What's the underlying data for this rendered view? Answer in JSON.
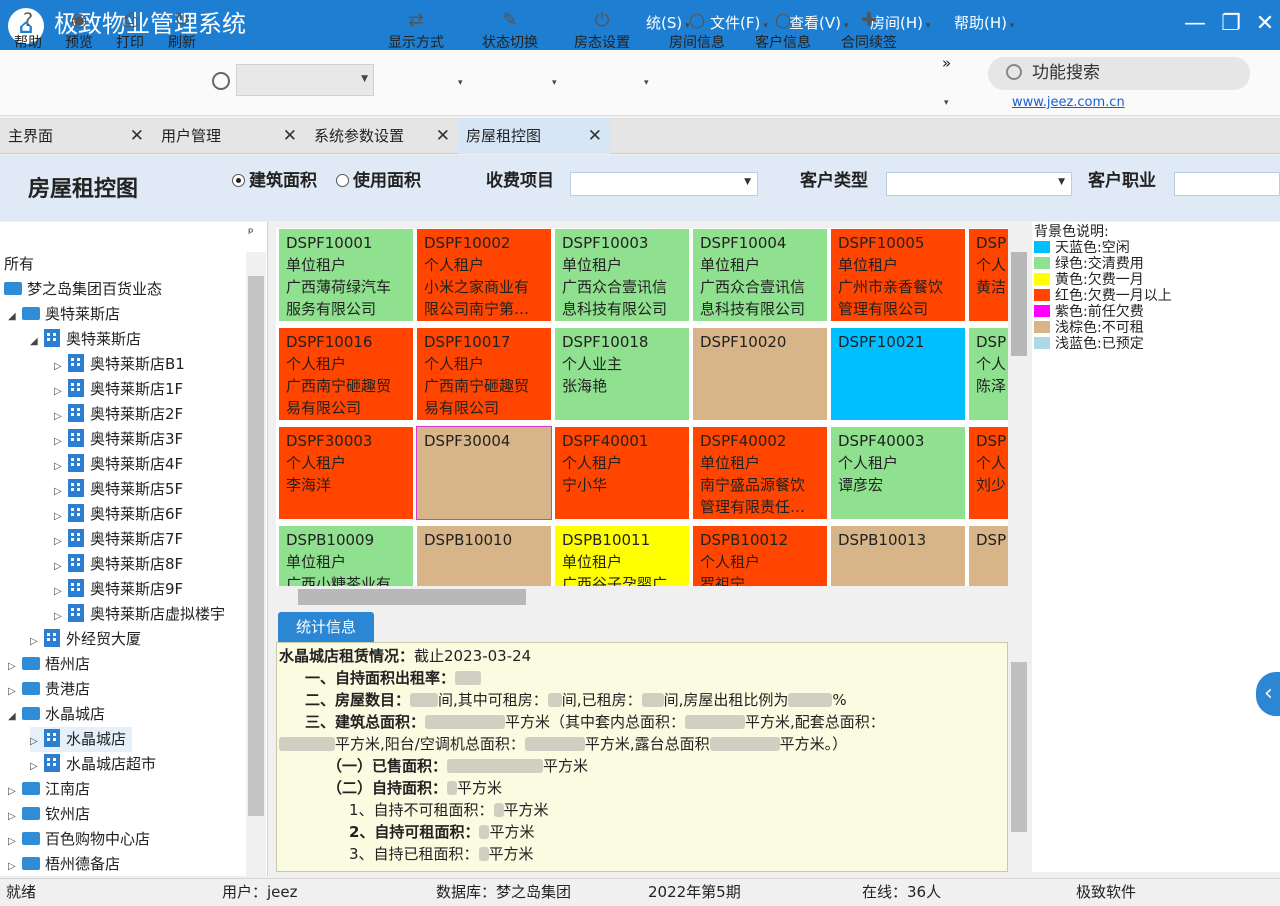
{
  "app": {
    "logo": "⌂",
    "title": "极致物业管理系统"
  },
  "menu": [
    "统(S)",
    "文件(F)",
    "查看(V)",
    "房间(H)",
    "帮助(H)"
  ],
  "window_controls": [
    "—",
    "❐",
    "✕"
  ],
  "toolbar": {
    "items": [
      {
        "label": "帮助",
        "icon": "?"
      },
      {
        "label": "预览",
        "icon": "◉"
      },
      {
        "label": "打印",
        "icon": "⎙"
      },
      {
        "label": "刷新",
        "icon": "↻"
      },
      {
        "label": "显示方式",
        "icon": "⇄"
      },
      {
        "label": "状态切换",
        "icon": "✎"
      },
      {
        "label": "房态设置",
        "icon": "⏻"
      },
      {
        "label": "房间信息",
        "icon": "○"
      },
      {
        "label": "客户信息",
        "icon": "○"
      },
      {
        "label": "合同续签",
        "icon": "✚"
      }
    ],
    "more": "»",
    "search_placeholder": "功能搜索",
    "site_link": "www.jeez.com.cn"
  },
  "tabs": [
    {
      "label": "主界面"
    },
    {
      "label": "用户管理"
    },
    {
      "label": "系统参数设置"
    },
    {
      "label": "房屋租控图"
    }
  ],
  "header": {
    "title": "房屋租控图",
    "radio_building_area": "建筑面积",
    "radio_use_area": "使用面积",
    "fee_label": "收费项目",
    "customer_type_label": "客户类型",
    "customer_job_label": "客户职业"
  },
  "tree": {
    "pin": "ᵖ",
    "all": "所有",
    "nodes": [
      {
        "label": "梦之岛集团百货业态"
      },
      {
        "label": "奥特莱斯店"
      },
      {
        "label": "奥特莱斯店"
      },
      {
        "label": "奥特莱斯店B1"
      },
      {
        "label": "奥特莱斯店1F"
      },
      {
        "label": "奥特莱斯店2F"
      },
      {
        "label": "奥特莱斯店3F"
      },
      {
        "label": "奥特莱斯店4F"
      },
      {
        "label": "奥特莱斯店5F"
      },
      {
        "label": "奥特莱斯店6F"
      },
      {
        "label": "奥特莱斯店7F"
      },
      {
        "label": "奥特莱斯店8F"
      },
      {
        "label": "奥特莱斯店9F"
      },
      {
        "label": "奥特莱斯店虚拟楼宇"
      },
      {
        "label": "外经贸大厦"
      },
      {
        "label": "梧州店"
      },
      {
        "label": "贵港店"
      },
      {
        "label": "水晶城店"
      },
      {
        "label": "水晶城店"
      },
      {
        "label": "水晶城店超市"
      },
      {
        "label": "江南店"
      },
      {
        "label": "钦州店"
      },
      {
        "label": "百色购物中心店"
      },
      {
        "label": "梧州德备店"
      }
    ]
  },
  "colors": {
    "free": "#00bfff",
    "paid": "#8fe08f",
    "overdue_1m": "#ffff00",
    "overdue_more": "#ff4500",
    "prev_overdue": "#ff00ff",
    "not_rentable": "#d8b589",
    "reserved": "#add8e6"
  },
  "rooms": [
    [
      {
        "code": "DSPF10001",
        "type": "单位租户",
        "l1": "广西薄荷绿汽车",
        "l2": "服务有限公司",
        "color": "#8fe08f"
      },
      {
        "code": "DSPF10002",
        "type": "个人租户",
        "l1": "小米之家商业有",
        "l2": "限公司南宁第…",
        "color": "#ff4500"
      },
      {
        "code": "DSPF10003",
        "type": "单位租户",
        "l1": "广西众合壹讯信",
        "l2": "息科技有限公司",
        "color": "#8fe08f"
      },
      {
        "code": "DSPF10004",
        "type": "单位租户",
        "l1": "广西众合壹讯信",
        "l2": "息科技有限公司",
        "color": "#8fe08f"
      },
      {
        "code": "DSPF10005",
        "type": "单位租户",
        "l1": "广州市亲香餐饮",
        "l2": "管理有限公司",
        "color": "#ff4500"
      },
      {
        "code": "DSP",
        "type": "个人",
        "l1": "黄洁",
        "l2": "",
        "color": "#ff4500"
      }
    ],
    [
      {
        "code": "DSPF10016",
        "type": "个人租户",
        "l1": "广西南宁砸趣贸",
        "l2": "易有限公司",
        "color": "#ff4500"
      },
      {
        "code": "DSPF10017",
        "type": "个人租户",
        "l1": "广西南宁砸趣贸",
        "l2": "易有限公司",
        "color": "#ff4500"
      },
      {
        "code": "DSPF10018",
        "type": "个人业主",
        "l1": "张海艳",
        "l2": "",
        "color": "#8fe08f"
      },
      {
        "code": "DSPF10020",
        "type": "",
        "l1": "",
        "l2": "",
        "color": "#d8b589"
      },
      {
        "code": "DSPF10021",
        "type": "",
        "l1": "",
        "l2": "",
        "color": "#00bfff"
      },
      {
        "code": "DSP",
        "type": "个人",
        "l1": "陈泽",
        "l2": "",
        "color": "#8fe08f"
      }
    ],
    [
      {
        "code": "DSPF30003",
        "type": "个人租户",
        "l1": "李海洋",
        "l2": "",
        "color": "#ff4500"
      },
      {
        "code": "DSPF30004",
        "type": "",
        "l1": "",
        "l2": "",
        "color": "#d8b589"
      },
      {
        "code": "DSPF40001",
        "type": "个人租户",
        "l1": "宁小华",
        "l2": "",
        "color": "#ff4500"
      },
      {
        "code": "DSPF40002",
        "type": "单位租户",
        "l1": "南宁盛品源餐饮",
        "l2": "管理有限责任…",
        "color": "#ff4500"
      },
      {
        "code": "DSPF40003",
        "type": "个人租户",
        "l1": "谭彦宏",
        "l2": "",
        "color": "#8fe08f"
      },
      {
        "code": "DSP",
        "type": "个人",
        "l1": "刘少",
        "l2": "",
        "color": "#ff4500"
      }
    ],
    [
      {
        "code": "DSPB10009",
        "type": "单位租户",
        "l1": "广西小糖茶业有",
        "l2": "",
        "color": "#8fe08f"
      },
      {
        "code": "DSPB10010",
        "type": "",
        "l1": "",
        "l2": "",
        "color": "#d8b589"
      },
      {
        "code": "DSPB10011",
        "type": "单位租户",
        "l1": "广西谷子孕婴广",
        "l2": "",
        "color": "#ffff00"
      },
      {
        "code": "DSPB10012",
        "type": "个人租户",
        "l1": "罗祖宁",
        "l2": "",
        "color": "#ff4500"
      },
      {
        "code": "DSPB10013",
        "type": "",
        "l1": "",
        "l2": "",
        "color": "#d8b589"
      },
      {
        "code": "DSP",
        "type": "",
        "l1": "",
        "l2": "",
        "color": "#d8b589"
      }
    ]
  ],
  "legend": {
    "title": "背景色说明:",
    "items": [
      {
        "label": "天蓝色:空闲",
        "color": "#00bfff"
      },
      {
        "label": "绿色:交清费用",
        "color": "#8fe08f"
      },
      {
        "label": "黄色:欠费一月",
        "color": "#ffff00"
      },
      {
        "label": "红色:欠费一月以上",
        "color": "#ff4500"
      },
      {
        "label": "紫色:前任欠费",
        "color": "#ff00ff"
      },
      {
        "label": "浅棕色:不可租",
        "color": "#d8b589"
      },
      {
        "label": "浅蓝色:已预定",
        "color": "#add8e6"
      }
    ]
  },
  "stats": {
    "tab": "统计信息",
    "title": "水晶城店租赁情况：",
    "date": "截止2023-03-24",
    "l1": "一、自持面积出租率：",
    "l2a": "二、房屋数目：",
    "l2b": "间,其中可租房：",
    "l2c": "间,已租房：",
    "l2d": "间,房屋出租比例为",
    "l2e": "%",
    "l3a": "三、建筑总面积：",
    "l3b": "平方米（其中套内总面积：",
    "l3c": "平方米,配套总面积：",
    "l4a": "平方米,阳台/空调机总面积：",
    "l4b": "平方米,露台总面积",
    "l4c": "平方米。）",
    "l5a": "（一）已售面积：",
    "l5b": "平方米",
    "l6a": "（二）自持面积：",
    "l6b": "平方米",
    "l7a": "1、自持不可租面积：",
    "l7b": "平方米",
    "l8a": "2、自持可租面积：",
    "l8b": "平方米",
    "l9a": "3、自持已租面积：",
    "l9b": "平方米"
  },
  "side_button": "‹",
  "status": {
    "ready": "就绪",
    "user": "用户：jeez",
    "db": "数据库：梦之岛集团",
    "period": "2022年第5期",
    "online": "在线：36人",
    "brand": "极致软件"
  }
}
